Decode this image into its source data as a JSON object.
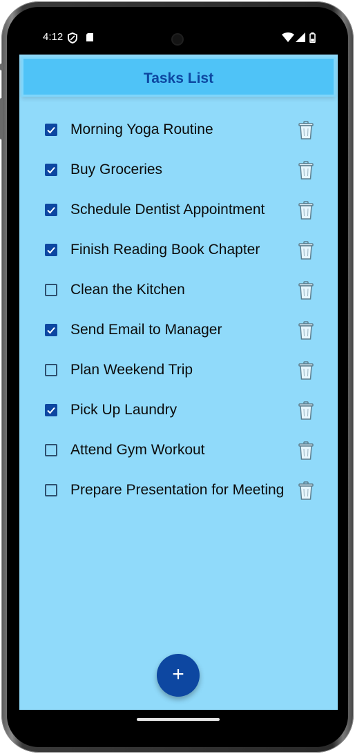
{
  "status_bar": {
    "time": "4:12"
  },
  "app_bar": {
    "title": "Tasks List"
  },
  "tasks": [
    {
      "label": "Morning Yoga Routine",
      "checked": true
    },
    {
      "label": "Buy Groceries",
      "checked": true
    },
    {
      "label": "Schedule Dentist Appointment",
      "checked": true
    },
    {
      "label": "Finish Reading Book Chapter",
      "checked": true
    },
    {
      "label": "Clean the Kitchen",
      "checked": false
    },
    {
      "label": "Send Email to Manager",
      "checked": true
    },
    {
      "label": "Plan Weekend Trip",
      "checked": false
    },
    {
      "label": "Pick Up Laundry",
      "checked": true
    },
    {
      "label": "Attend Gym Workout",
      "checked": false
    },
    {
      "label": "Prepare Presentation for Meeting",
      "checked": false
    }
  ],
  "fab": {
    "label": "+"
  },
  "icons": {
    "checkbox": "checkbox-icon",
    "delete": "trash-icon",
    "add": "plus-icon"
  },
  "colors": {
    "background": "#90dafa",
    "app_bar": "#4fc3f7",
    "title": "#0d47a1",
    "checkbox_checked": "#0d47a1",
    "fab": "#0d47a1"
  }
}
